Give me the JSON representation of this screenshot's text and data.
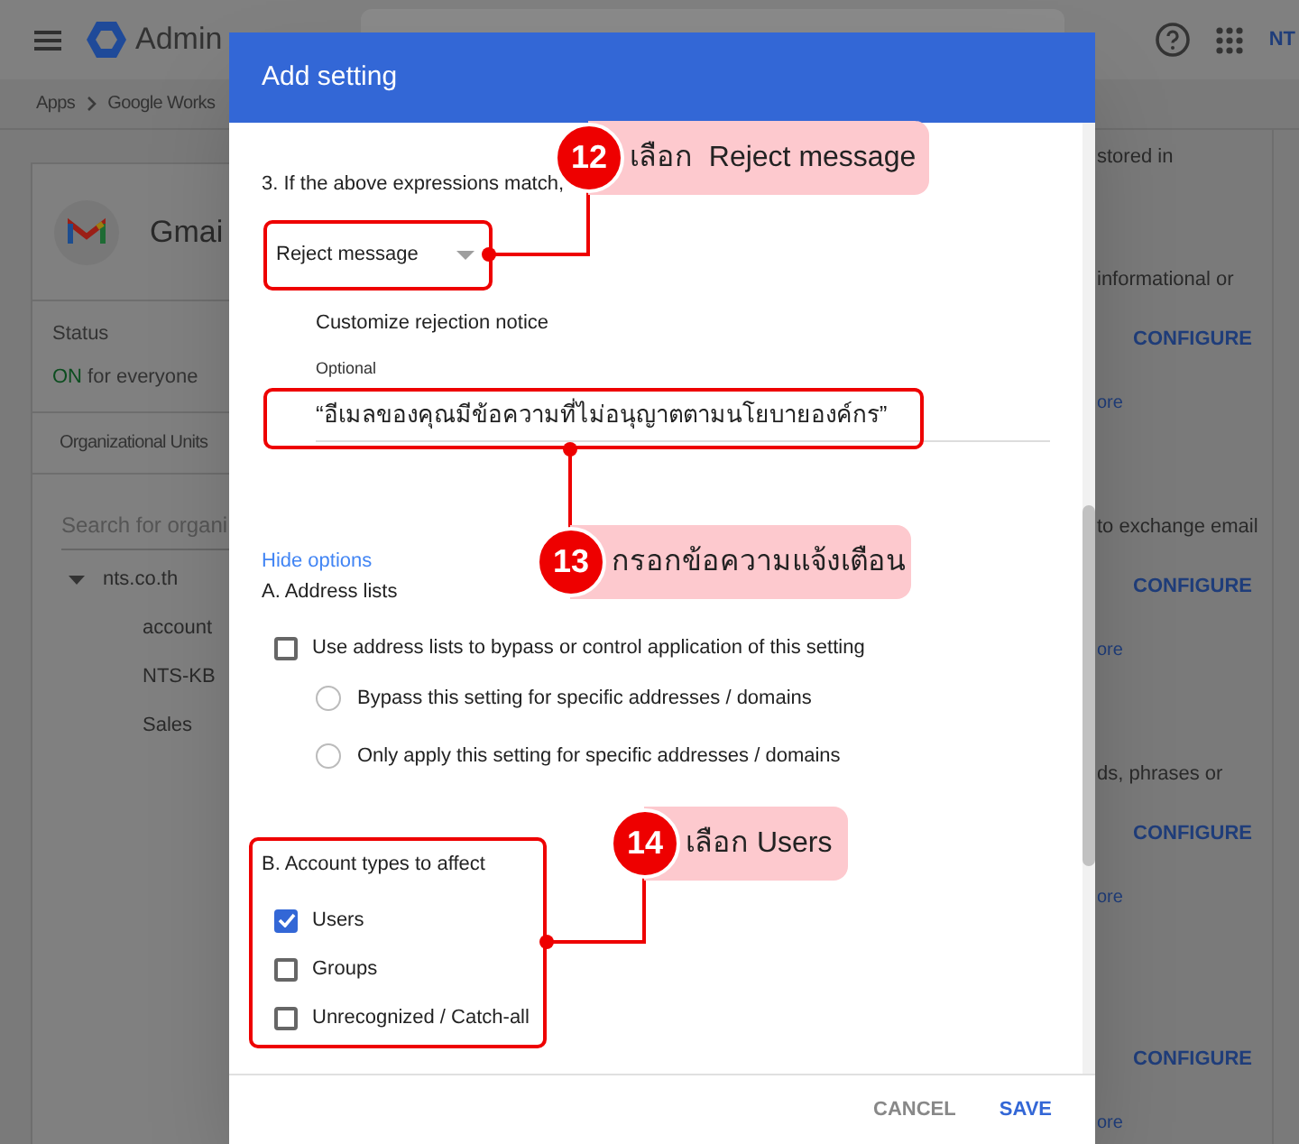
{
  "header": {
    "app_name": "Admin",
    "brand": "NT"
  },
  "breadcrumb": [
    "Apps",
    "Google Works"
  ],
  "app_card": {
    "title": "Gmai",
    "status_label": "Status",
    "status_value": "ON",
    "status_text": "for everyone"
  },
  "org_units": {
    "heading": "Organizational Units",
    "search_placeholder": "Search for organi",
    "tree": [
      {
        "label": "nts.co.th",
        "expanded": true,
        "children": [
          {
            "label": "account"
          },
          {
            "label": "NTS-KB"
          },
          {
            "label": "Sales"
          }
        ]
      }
    ]
  },
  "right_panel": [
    {
      "description": "stored in"
    },
    {
      "description": "informational or",
      "button": "CONFIGURE",
      "link": "ore"
    },
    {
      "description": "to exchange email",
      "button": "CONFIGURE",
      "link": "ore"
    },
    {
      "description": "ds, phrases or",
      "button": "CONFIGURE",
      "link": "ore"
    },
    {
      "button": "CONFIGURE",
      "link": "ore"
    }
  ],
  "dialog": {
    "title": "Add setting",
    "step_label": "3. If the above expressions match,",
    "action_select": {
      "value": "Reject message"
    },
    "notice_label": "Customize rejection notice",
    "notice_field": {
      "label": "Optional",
      "value": "“อีเมลของคุณมีข้อความที่ไม่อนุญาตตามนโยบายองค์กร”"
    },
    "options_link": "Hide options",
    "address_lists": {
      "heading": "A. Address lists",
      "checkbox": {
        "label": "Use address lists to bypass or control application of this setting",
        "checked": false
      },
      "radios": [
        {
          "label": "Bypass this setting for specific addresses / domains",
          "selected": false
        },
        {
          "label": "Only apply this setting for specific addresses / domains",
          "selected": false
        }
      ]
    },
    "account_types": {
      "heading": "B. Account types to affect",
      "options": [
        {
          "label": "Users",
          "checked": true
        },
        {
          "label": "Groups",
          "checked": false
        },
        {
          "label": "Unrecognized / Catch-all",
          "checked": false
        }
      ]
    },
    "buttons": [
      {
        "label": "CANCEL",
        "kind": "secondary"
      },
      {
        "label": "SAVE",
        "kind": "primary"
      }
    ]
  },
  "annotations": [
    {
      "number": "12",
      "text": "เลือก  Reject message"
    },
    {
      "number": "13",
      "text": "กรอกข้อความแจ้งเตือน"
    },
    {
      "number": "14",
      "text": "เลือก Users"
    }
  ]
}
